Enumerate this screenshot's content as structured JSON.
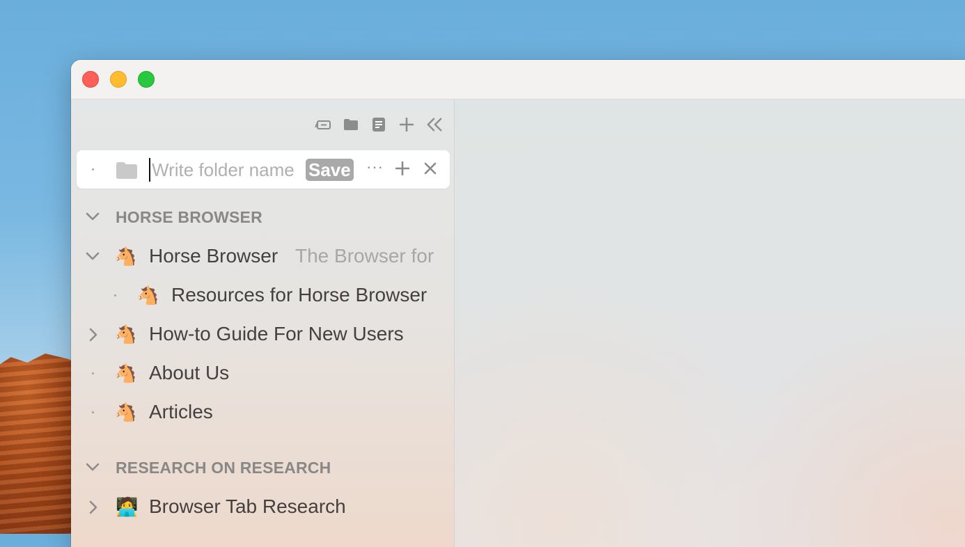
{
  "window": {
    "traffic_lights": [
      "close",
      "minimize",
      "zoom"
    ]
  },
  "toolbar": {
    "icons": [
      "tabs-icon",
      "folder-icon",
      "note-icon",
      "plus-icon",
      "collapse-sidebar-icon"
    ]
  },
  "new_folder": {
    "placeholder": "Write folder name",
    "value": "",
    "save_label": "Save",
    "more_label": "···"
  },
  "sections": [
    {
      "title": "HORSE BROWSER",
      "items": [
        {
          "icon": "🐴",
          "title": "Horse Browser",
          "subtitle": "The Browser for",
          "expanded": true
        },
        {
          "icon": "🐴",
          "title": "Resources for Horse Browser"
        },
        {
          "icon": "🐴",
          "title": "How-to Guide For New Users",
          "expandable": true
        },
        {
          "icon": "🐴",
          "title": "About Us"
        },
        {
          "icon": "🐴",
          "title": "Articles"
        }
      ]
    },
    {
      "title": "RESEARCH ON RESEARCH",
      "items": [
        {
          "icon": "🧑‍💻",
          "title": "Browser Tab Research",
          "expandable": true
        }
      ]
    }
  ]
}
